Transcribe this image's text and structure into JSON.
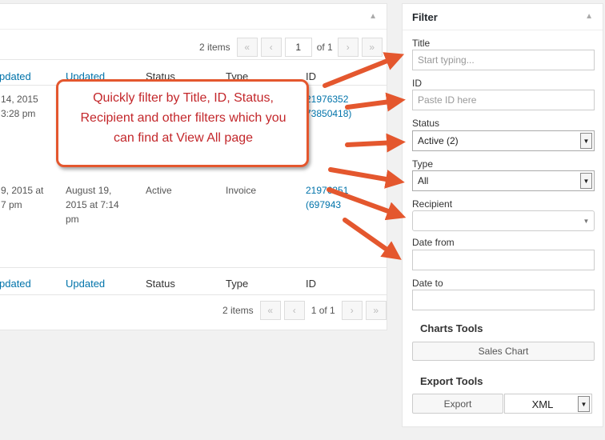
{
  "pagination_top": {
    "count": "2 items",
    "first": "«",
    "prev": "‹",
    "page": "1",
    "of": "of 1",
    "next": "›",
    "last": "»"
  },
  "pagination_bottom": {
    "count": "2 items",
    "first": "«",
    "prev": "‹",
    "page_text": "1 of 1",
    "next": "›",
    "last": "»"
  },
  "columns": {
    "c1": "pdated",
    "c2": "Updated",
    "c3": "Status",
    "c4": "Type",
    "c5": "ID"
  },
  "columns_footer": {
    "c1": "pdated",
    "c2": "Updated",
    "c3": "Status",
    "c4": "Type",
    "c5": "ID"
  },
  "rows": [
    {
      "created_line1": "14, 2015",
      "created_line2": "3:28 pm",
      "id_line1": "21976352",
      "id_line2": "73850418)"
    },
    {
      "created_line1": "9, 2015 at",
      "created_line2": "7 pm",
      "updated_line1": "August 19,",
      "updated_line2": "2015 at 7:14",
      "updated_line3": "pm",
      "status": "Active",
      "type": "Invoice",
      "id_line1": "21976351",
      "id_line2": "(697943"
    }
  ],
  "callout": {
    "text": "Quickly filter by Title, ID, Status, Recipient and other filters which you can find at View All page"
  },
  "filter": {
    "title": "Filter",
    "title_label": "Title",
    "title_placeholder": "Start typing...",
    "id_label": "ID",
    "id_placeholder": "Paste ID here",
    "status_label": "Status",
    "status_value": "Active (2)",
    "type_label": "Type",
    "type_value": "All",
    "recipient_label": "Recipient",
    "recipient_value": "",
    "date_from_label": "Date from",
    "date_to_label": "Date to"
  },
  "charts_tools": {
    "title": "Charts Tools",
    "sales_chart": "Sales Chart"
  },
  "export_tools": {
    "title": "Export Tools",
    "export": "Export",
    "format": "XML"
  },
  "colors": {
    "link": "#0073aa",
    "callout_border": "#e4572e",
    "callout_text": "#c3272b",
    "arrow": "#e4572e"
  },
  "icons": {
    "collapse": "triangle-up-icon",
    "dropdown": "chevron-down-icon"
  }
}
